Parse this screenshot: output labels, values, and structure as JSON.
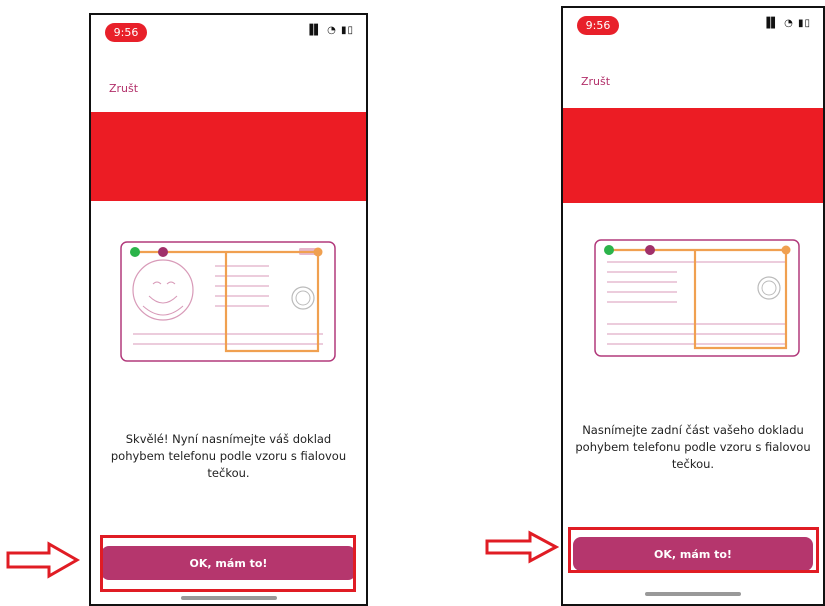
{
  "phones": [
    {
      "time": "9:56",
      "cancel_label": "Zrušt",
      "instruction": "Skvělé! Nyní nasnímejte váš doklad pohybem telefonu podle vzoru s fialovou tečkou.",
      "ok_label": "OK, mám to!",
      "card_side": "front"
    },
    {
      "time": "9:56",
      "cancel_label": "Zrušt",
      "instruction": "Nasnímejte zadní část vašeho dokladu pohybem telefonu podle vzoru s fialovou tečkou.",
      "ok_label": "OK, mám to!",
      "card_side": "back"
    }
  ],
  "colors": {
    "banner": "#ec1c24",
    "accent": "#b5366d",
    "card_outline": "#b23a7c",
    "path": "#f0a050",
    "dot_start": "#2bb34a",
    "dot_purple": "#a0306a",
    "highlight": "#e01c24"
  },
  "icons": {
    "status": [
      "signal-icon",
      "wifi-icon",
      "battery-icon"
    ],
    "annotation": "right-arrow-icon"
  }
}
